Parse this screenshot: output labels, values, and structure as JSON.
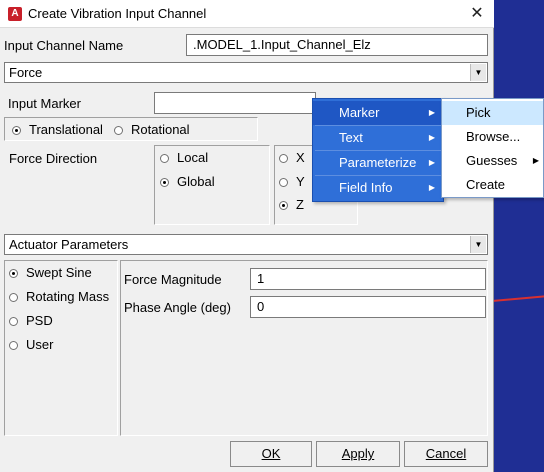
{
  "window": {
    "title": "Create Vibration Input Channel",
    "app_icon": "A"
  },
  "form": {
    "channel_name_label": "Input Channel Name",
    "channel_name_value": ".MODEL_1.Input_Channel_Elz",
    "input_type": "Force",
    "input_marker_label": "Input Marker",
    "input_marker_value": "",
    "motion_options": [
      "Translational",
      "Rotational"
    ],
    "force_direction_label": "Force Direction",
    "frame_options": [
      "Local",
      "Global"
    ],
    "axis_options": [
      "X",
      "Y",
      "Z"
    ],
    "actuator_select": "Actuator Parameters",
    "actuator_types": [
      "Swept Sine",
      "Rotating Mass",
      "PSD",
      "User"
    ],
    "force_magnitude_label": "Force Magnitude",
    "force_magnitude_value": "1",
    "phase_angle_label": "Phase Angle (deg)",
    "phase_angle_value": "0"
  },
  "buttons": {
    "ok": "OK",
    "apply": "Apply",
    "cancel": "Cancel"
  },
  "context_menu": {
    "items": [
      "Marker",
      "Text",
      "Parameterize",
      "Field Info"
    ],
    "submenu_items": [
      "Pick",
      "Browse...",
      "Guesses",
      "Create"
    ]
  },
  "icons": {
    "close": "close-icon",
    "dropdown": "chevron-down-icon",
    "submenu": "chevron-right-icon"
  },
  "colors": {
    "menu_blue": "#2f6fd8",
    "menu_highlight": "#cce8ff",
    "background": "#1a2a8c"
  }
}
